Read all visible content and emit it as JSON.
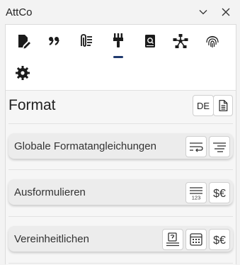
{
  "window": {
    "title": "AttCo",
    "collapse_icon": "chevron-down-icon",
    "close_icon": "close-icon"
  },
  "tabs": [
    {
      "icon": "edit-document-icon",
      "selected": false
    },
    {
      "icon": "quote-icon",
      "selected": false
    },
    {
      "icon": "attachment-list-icon",
      "selected": false
    },
    {
      "icon": "paintbrush-icon",
      "selected": true
    },
    {
      "icon": "book-search-icon",
      "selected": false
    },
    {
      "icon": "network-icon",
      "selected": false
    },
    {
      "icon": "fingerprint-icon",
      "selected": false
    },
    {
      "icon": "gear-icon",
      "selected": false
    }
  ],
  "format": {
    "title": "Format",
    "lang_label": "DE",
    "groups": [
      {
        "label": "Globale Formatangleichungen"
      },
      {
        "label": "Ausformulieren",
        "number_label": "123"
      },
      {
        "label": "Vereinheitlichen"
      }
    ]
  },
  "colors": {
    "accent": "#1f3a6e",
    "icon": "#1b1b1b",
    "group_bg": "#ececec"
  }
}
